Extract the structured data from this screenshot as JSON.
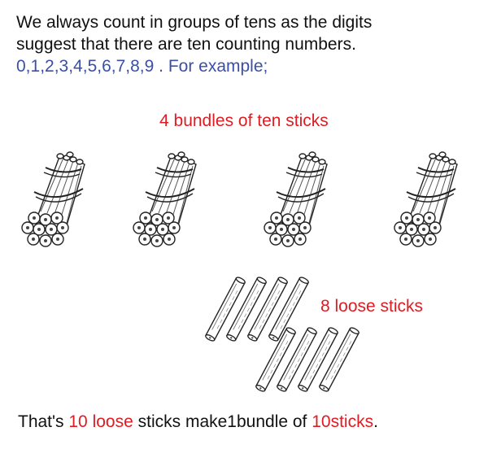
{
  "intro": {
    "line1": "We always count in groups of tens as the digits",
    "line2": "suggest that there are ten counting numbers.",
    "digits": "0,1,2,3,4,5,6,7,8,9",
    "suffix": " . For example;"
  },
  "bundles_label": "4 bundles of ten sticks",
  "loose_label": "8 loose sticks",
  "summary": {
    "part1": "That's ",
    "part2": "10 loose",
    "part3": " sticks make1bundle of ",
    "part4": "10sticks",
    "part5": "."
  },
  "counts": {
    "bundles": 4,
    "loose_sticks": 8
  },
  "colors": {
    "text": "#111111",
    "accent_red": "#e11b22",
    "digits_blue": "#3a4fa8"
  }
}
